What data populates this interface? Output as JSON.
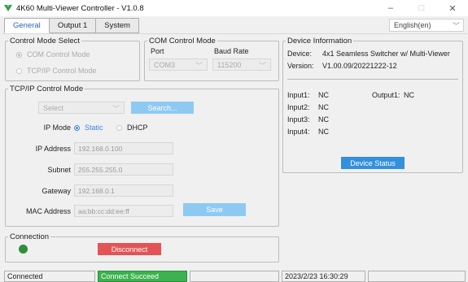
{
  "window": {
    "title": "4K60 Multi-Viewer Controller - V1.0.8",
    "minimize": "–",
    "maximize": "□",
    "close": "✕"
  },
  "tabs": [
    {
      "label": "General",
      "active": true
    },
    {
      "label": "Output 1",
      "active": false
    },
    {
      "label": "System",
      "active": false
    }
  ],
  "language": {
    "selected": "English(en)"
  },
  "control_mode": {
    "legend": "Control Mode Select",
    "com_label": "COM Control Mode",
    "tcpip_label": "TCP/IP Control Mode"
  },
  "com_mode": {
    "legend": "COM Control Mode",
    "port_label": "Port",
    "baud_label": "Baud Rate",
    "port_value": "COM3",
    "baud_value": "115200"
  },
  "tcpip": {
    "legend": "TCP/IP Control Mode",
    "select_value": "Select",
    "search_label": "Search...",
    "ip_mode_label": "IP Mode",
    "static_label": "Static",
    "dhcp_label": "DHCP",
    "ip_label": "IP Address",
    "ip_value": "192.168.0.100",
    "subnet_label": "Subnet",
    "subnet_value": "255.255.255.0",
    "gateway_label": "Gateway",
    "gateway_value": "192.168.0.1",
    "mac_label": "MAC Address",
    "mac_value": "aa:bb:cc:dd:ee:ff",
    "save_label": "Save"
  },
  "connection": {
    "legend": "Connection",
    "disconnect_label": "Disconnect"
  },
  "device_info": {
    "legend": "Device Information",
    "device_label": "Device:",
    "device_value": "4x1 Seamless Switcher w/ Multi-Viewer",
    "version_label": "Version:",
    "version_value": "V1.00.09/20221222-12",
    "inputs": [
      {
        "label": "Input1:",
        "value": "NC"
      },
      {
        "label": "Input2:",
        "value": "NC"
      },
      {
        "label": "Input3:",
        "value": "NC"
      },
      {
        "label": "Input4:",
        "value": "NC"
      }
    ],
    "output_label": "Output1:",
    "output_value": "NC",
    "status_button": "Device Status"
  },
  "statusbar": {
    "state": "Connected",
    "message": "Connect Succeed",
    "datetime": "2023/2/23 16:30:29"
  },
  "colors": {
    "accent_blue": "#3390dd",
    "disconnect_red": "#e25455",
    "status_green": "#3bb24e",
    "led_green": "#2e8f38"
  }
}
